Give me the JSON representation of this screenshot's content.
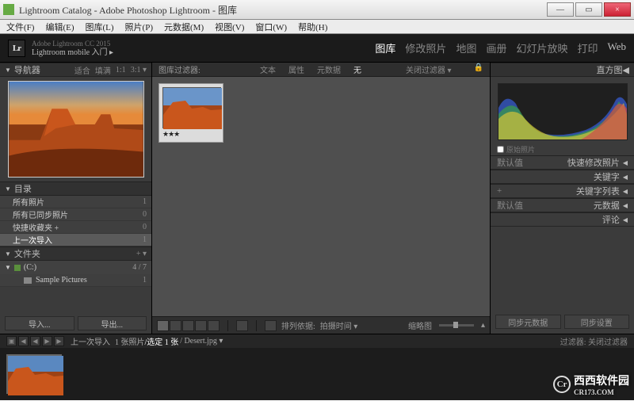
{
  "window": {
    "title": "Lightroom Catalog - Adobe Photoshop Lightroom - 图库",
    "min": "—",
    "max": "▭",
    "close": "×"
  },
  "menubar": [
    "文件(F)",
    "编辑(E)",
    "图库(L)",
    "照片(P)",
    "元数据(M)",
    "视图(V)",
    "窗口(W)",
    "帮助(H)"
  ],
  "brand": {
    "logo": "Lr",
    "line1": "Adobe Lightroom CC 2015",
    "line2": "Lightroom mobile 入门  ▸"
  },
  "modules": {
    "items": [
      "图库",
      "修改照片",
      "地图",
      "画册",
      "幻灯片放映",
      "打印",
      "Web"
    ],
    "active": "图库"
  },
  "navigator": {
    "title": "导航器",
    "opts": [
      "适合",
      "填满",
      "1:1",
      "3:1 ▾"
    ]
  },
  "catalog": {
    "title": "目录",
    "items": [
      {
        "label": "所有照片",
        "count": "1"
      },
      {
        "label": "所有已同步照片",
        "count": "0"
      },
      {
        "label": "快捷收藏夹 +",
        "count": "0"
      },
      {
        "label": "上一次导入",
        "count": "1",
        "selected": true
      }
    ]
  },
  "folders": {
    "title": "文件夹",
    "plus": "+ ▾",
    "device": "(C:)",
    "device_count": "4 / 7",
    "item": "Sample Pictures",
    "item_count": "1"
  },
  "leftbtns": {
    "import": "导入...",
    "export": "导出..."
  },
  "filter": {
    "label": "图库过滤器:",
    "opts": [
      "文本",
      "属性",
      "元数据",
      "无"
    ],
    "active": "无",
    "close_label": "关闭过滤器 ▾",
    "lock": "🔒"
  },
  "thumb": {
    "stars": "★★★"
  },
  "toolbar": {
    "sortlabel": "排列依据:",
    "sortval": "拍摄时间 ▾",
    "zoomlabel": "缩略图",
    "tri": "▴"
  },
  "righttop": {
    "title": "直方图"
  },
  "origphoto": "原始照片",
  "rpanels": [
    {
      "left": "默认值",
      "right": "快速修改照片"
    },
    {
      "left": "",
      "right": "关键字"
    },
    {
      "left": "+",
      "right": "关键字列表"
    },
    {
      "left": "默认值",
      "right": "元数据"
    },
    {
      "left": "",
      "right": "评论"
    }
  ],
  "rbtns": {
    "sync_meta": "同步元数据",
    "sync_settings": "同步设置"
  },
  "status": {
    "arrows": [
      "◀",
      "◀",
      "▶",
      "▶"
    ],
    "path": "上一次导入",
    "count": "1 张照片",
    "sel": "/选定 1 张",
    "file": "/ Desert.jpg ▾",
    "filter_label": "过滤器:",
    "filter_val": "关闭过滤器"
  },
  "watermark": {
    "site": "CR173.COM",
    "text": "西西软件园"
  }
}
